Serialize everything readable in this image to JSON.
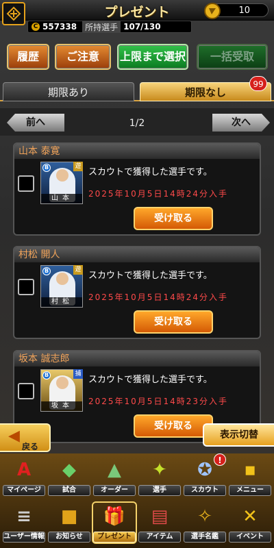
{
  "header": {
    "title": "プレゼント",
    "coins": "10"
  },
  "status": {
    "coin_symbol": "C",
    "money": "557338",
    "owned_label": "所持選手",
    "owned_value": "107/130"
  },
  "actions": {
    "history": "履歴",
    "notice": "ご注意",
    "select_max": "上限まで選択",
    "receive_all": "一括受取"
  },
  "tabs": {
    "with_limit": "期限あり",
    "no_limit": "期限なし",
    "no_limit_count": "99"
  },
  "pager": {
    "prev": "前へ",
    "next": "次へ",
    "page": "1/2"
  },
  "gifts": [
    {
      "name": "山本 泰寛",
      "position": "遊",
      "thumb_name": "山本",
      "description": "スカウトで獲得した選手です。",
      "date": "2025年10月5日14時24分入手",
      "receive": "受け取る"
    },
    {
      "name": "村松 開人",
      "position": "遊",
      "thumb_name": "村松",
      "description": "スカウトで獲得した選手です。",
      "date": "2025年10月5日14時24分入手",
      "receive": "受け取る"
    },
    {
      "name": "坂本 誠志郎",
      "position": "捕",
      "thumb_name": "坂本",
      "description": "スカウトで獲得した選手です。",
      "date": "2025年10月5日14時23分入手",
      "receive": "受け取る"
    }
  ],
  "overlay": {
    "back": "戻る",
    "toggle": "表示切替"
  },
  "nav": {
    "row1": [
      {
        "label": "マイページ",
        "icon": "A"
      },
      {
        "label": "試合",
        "icon": "◆"
      },
      {
        "label": "オーダー",
        "icon": "▲"
      },
      {
        "label": "選手",
        "icon": "✦"
      },
      {
        "label": "スカウト",
        "icon": "✪"
      },
      {
        "label": "メニュー",
        "icon": "▪"
      }
    ],
    "row2": [
      {
        "label": "ユーザー情報",
        "icon": "≡"
      },
      {
        "label": "お知らせ",
        "icon": "■"
      },
      {
        "label": "プレゼント",
        "icon": "🎁"
      },
      {
        "label": "アイテム",
        "icon": "▤"
      },
      {
        "label": "選手名鑑",
        "icon": "✧"
      },
      {
        "label": "イベント",
        "icon": "✕"
      }
    ],
    "scout_alert": "!"
  }
}
